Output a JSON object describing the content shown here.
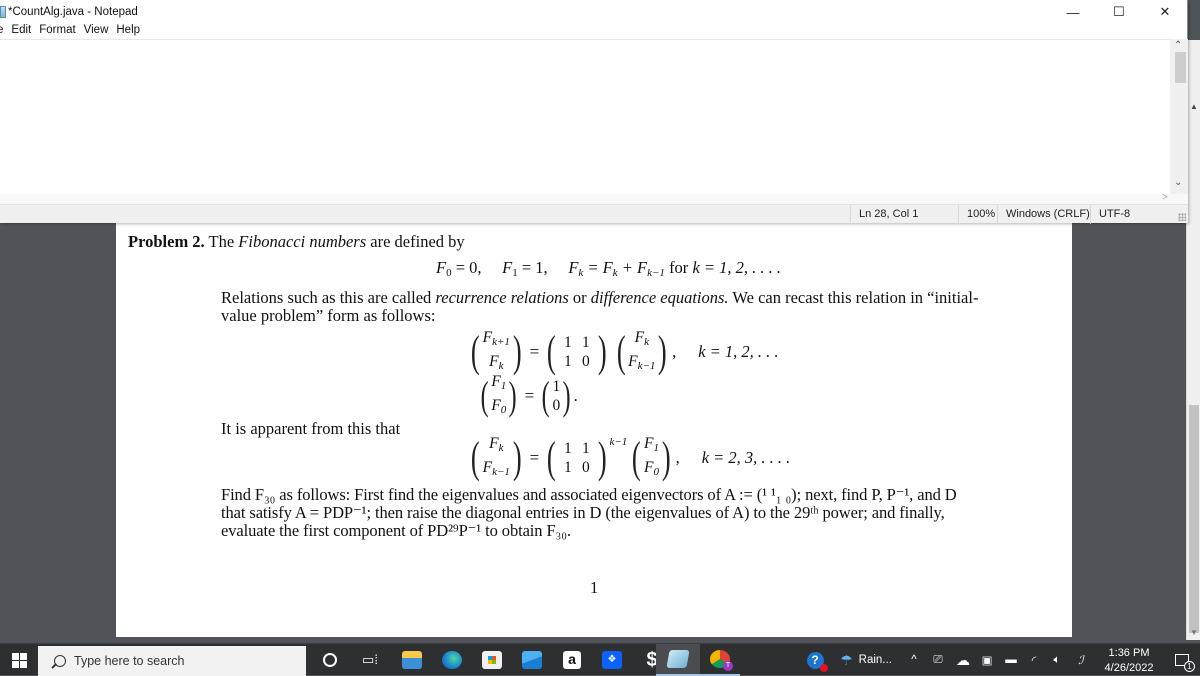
{
  "notepad": {
    "title": "*CountAlg.java - Notepad",
    "menu": [
      "e",
      "Edit",
      "Format",
      "View",
      "Help"
    ],
    "window_controls": {
      "minimize": "—",
      "maximize": "☐",
      "close": "✕"
    },
    "status": {
      "position": "Ln 28, Col 1",
      "zoom": "100%",
      "line_ending": "Windows (CRLF)",
      "encoding": "UTF-8"
    }
  },
  "document": {
    "problem_label": "Problem 2.",
    "intro_pre": "The",
    "intro_em": "Fibonacci numbers",
    "intro_post": "are defined by",
    "def_eq": {
      "f0": "F",
      "f0_sub": "0",
      "f0_val": "= 0,",
      "f1": "F",
      "f1_sub": "1",
      "f1_val": "= 1,",
      "fk": "F",
      "fk_sub": "k",
      "eq": "= F",
      "fk2_sub": "k",
      "plus": "+ F",
      "fk3_sub": "k−1",
      "for": "for",
      "k_range": "k = 1, 2, . . . ."
    },
    "para1_line1_a": "Relations such as this are called",
    "para1_em1": "recurrence relations",
    "para1_or": "or",
    "para1_em2": "difference equations.",
    "para1_line1_b": "We can recast this relation in “initial-",
    "para1_line2": "value problem” form as follows:",
    "system1": {
      "lhs": [
        "F_{k+1}",
        "F_k"
      ],
      "matrix": [
        "1",
        "1",
        "1",
        "0"
      ],
      "rhs": [
        "F_k",
        "F_{k−1}"
      ],
      "cond": "k = 1, 2, . . ."
    },
    "system2": {
      "lhs": [
        "F_1",
        "F_0"
      ],
      "rhs": [
        "1",
        "0"
      ]
    },
    "apparent": "It is apparent from this that",
    "system3": {
      "lhs": [
        "F_k",
        "F_{k−1}"
      ],
      "matrix": [
        "1",
        "1",
        "1",
        "0"
      ],
      "power": "k−1",
      "rhs": [
        "F_1",
        "F_0"
      ],
      "cond": "k = 2, 3, . . . ."
    },
    "find_line1": "Find F₃₀ as follows: First find the eigenvalues and associated eigenvectors of A := (¹ ¹₁ ₀); next, find P, P⁻¹, and D",
    "find_line2": "that satisfy A = PDP⁻¹; then raise the diagonal entries in D (the eigenvalues of A) to the 29ᵗʰ power; and finally,",
    "find_line3": "evaluate the first component of PD²⁹P⁻¹ to obtain F₃₀.",
    "page_number": "1"
  },
  "taskbar": {
    "search_placeholder": "Type here to search",
    "apps": [
      "cortana",
      "task-view",
      "file-explorer",
      "edge",
      "microsoft-store",
      "mail",
      "amazon",
      "dropbox",
      "app-s",
      "notepad",
      "chrome"
    ],
    "weather": "Rain...",
    "time": "1:36 PM",
    "date": "4/26/2022",
    "notification_count": "1"
  }
}
